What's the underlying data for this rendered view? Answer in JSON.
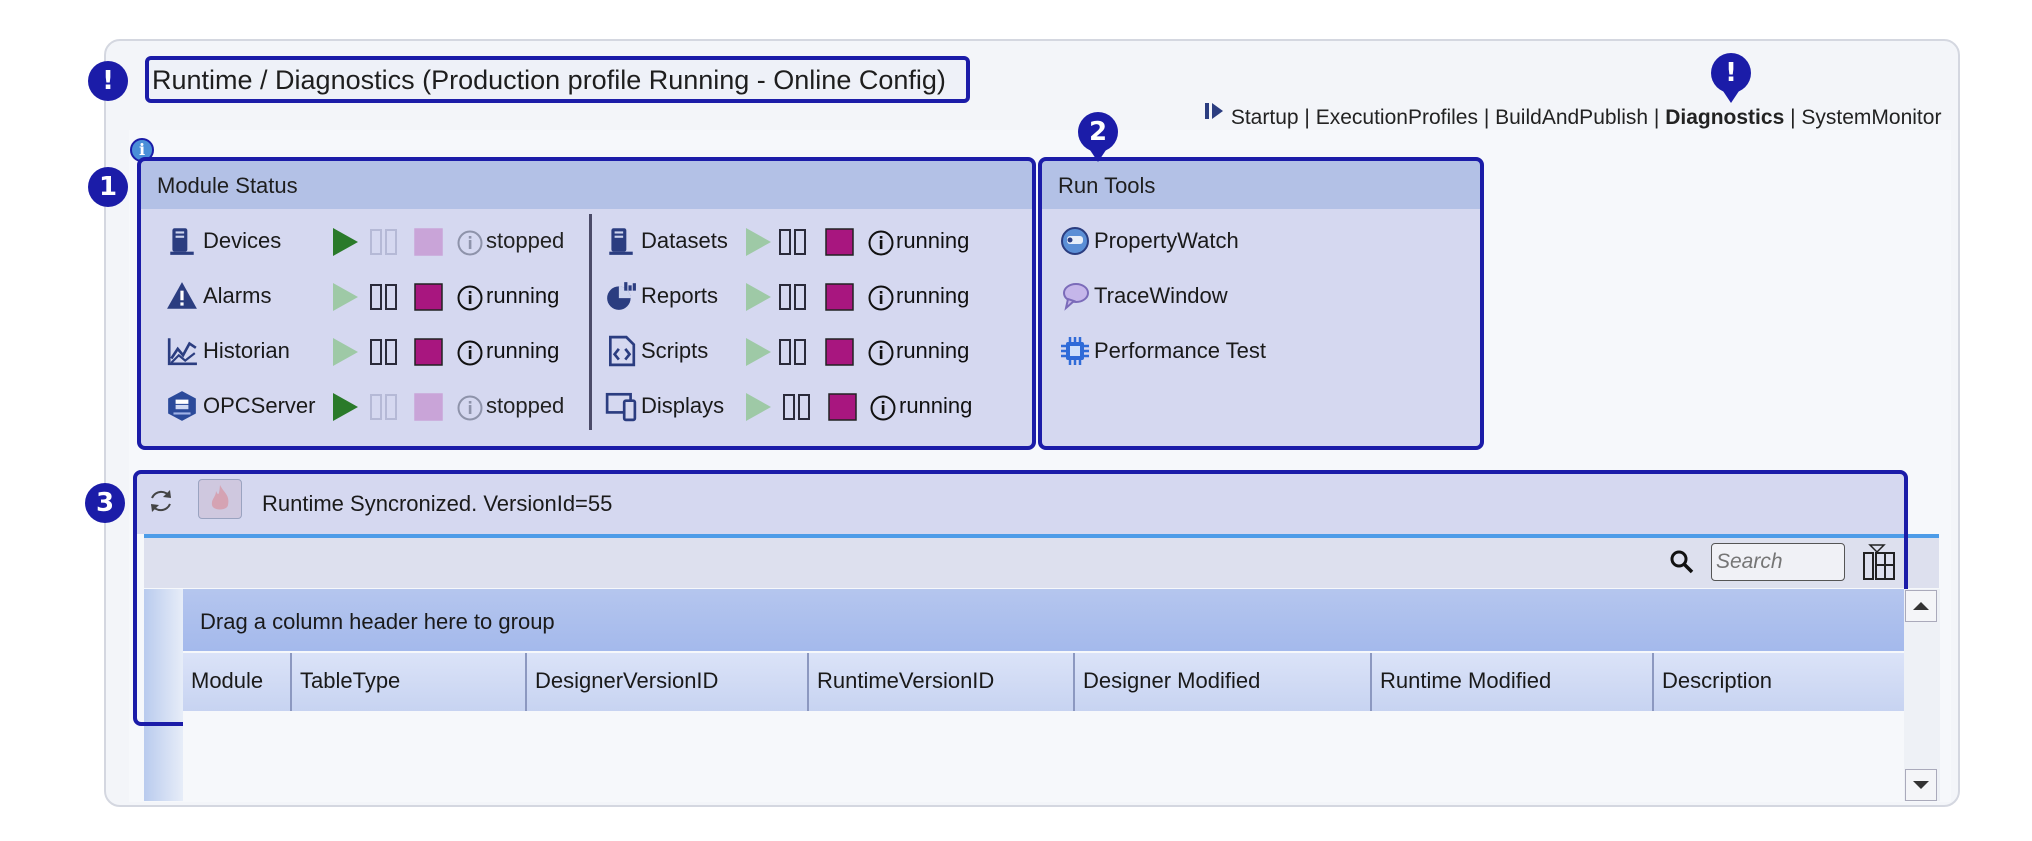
{
  "header": {
    "title": "Runtime / Diagnostics (Production profile Running - Online Config)"
  },
  "breadcrumb": {
    "items": [
      "Startup",
      "ExecutionProfiles",
      "BuildAndPublish",
      "Diagnostics",
      "SystemMonitor"
    ],
    "current": "Diagnostics",
    "separator": "|"
  },
  "badges": {
    "alert": "!",
    "one": "1",
    "two": "2",
    "three": "3",
    "info": "i"
  },
  "module_status": {
    "title": "Module Status",
    "modules": [
      {
        "label": "Devices",
        "status": "stopped",
        "icon": "devices-icon"
      },
      {
        "label": "Alarms",
        "status": "running",
        "icon": "alarm-icon"
      },
      {
        "label": "Historian",
        "status": "running",
        "icon": "historian-icon"
      },
      {
        "label": "OPCServer",
        "status": "stopped",
        "icon": "opc-server-icon"
      },
      {
        "label": "Datasets",
        "status": "running",
        "icon": "datasets-icon"
      },
      {
        "label": "Reports",
        "status": "running",
        "icon": "reports-icon"
      },
      {
        "label": "Scripts",
        "status": "running",
        "icon": "scripts-icon"
      },
      {
        "label": "Displays",
        "status": "running",
        "icon": "displays-icon"
      }
    ]
  },
  "run_tools": {
    "title": "Run Tools",
    "items": [
      {
        "label": "PropertyWatch",
        "icon": "property-watch-icon"
      },
      {
        "label": "TraceWindow",
        "icon": "trace-window-icon"
      },
      {
        "label": "Performance Test",
        "icon": "chip-icon"
      }
    ]
  },
  "sync": {
    "status": "Runtime Syncronized. VersionId=55"
  },
  "grid": {
    "search_placeholder": "Search",
    "group_hint": "Drag a column header here to group",
    "columns": [
      "Module",
      "TableType",
      "DesignerVersionID",
      "RuntimeVersionID",
      "Designer Modified",
      "Runtime Modified",
      "Description"
    ]
  },
  "colors": {
    "accent": "#1b1ca8",
    "panel": "#d5d8f0",
    "panel_header": "#b3c1e6",
    "stop_active": "#a8167f",
    "stop_inactive": "#c9a4d8",
    "play_active": "#2a7a2a",
    "play_inactive": "#9ec9a6"
  }
}
